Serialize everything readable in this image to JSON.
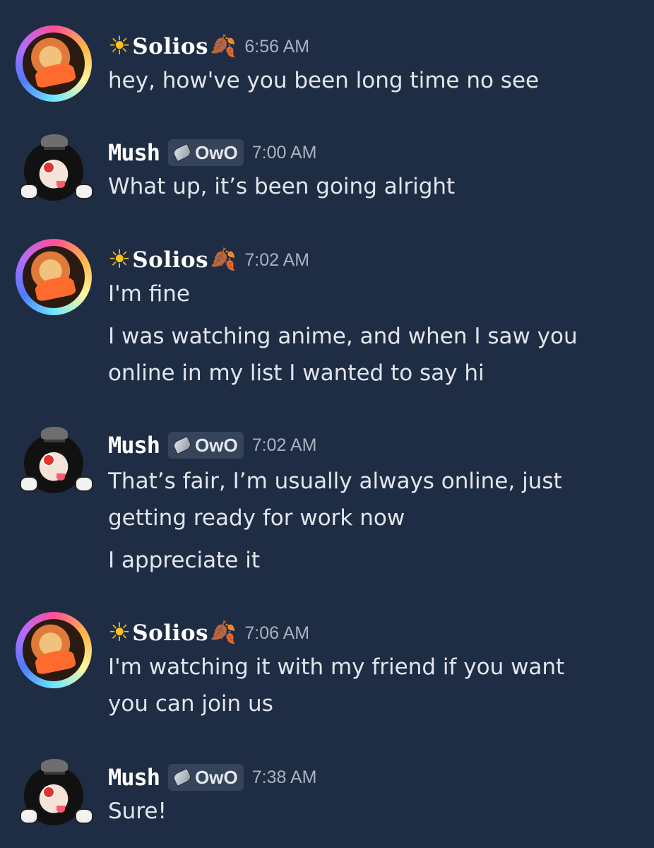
{
  "messages": [
    {
      "author": "Solios",
      "author_prefix_icon": "sun-emoji",
      "author_suffix_icon": "fallen-leaf-emoji",
      "time": "6:56 AM",
      "lines": [
        "hey, how've you been long time no see"
      ]
    },
    {
      "author": "Mush",
      "tag": "OwO",
      "tag_icon": "silver-leaf-icon",
      "time": "7:00 AM",
      "lines": [
        "What up, it’s been going alright"
      ]
    },
    {
      "author": "Solios",
      "author_prefix_icon": "sun-emoji",
      "author_suffix_icon": "fallen-leaf-emoji",
      "time": "7:02 AM",
      "lines": [
        "I'm fine",
        "I was watching anime, and when I saw you",
        "online in my list I wanted to say hi"
      ]
    },
    {
      "author": "Mush",
      "tag": "OwO",
      "tag_icon": "silver-leaf-icon",
      "time": "7:02 AM",
      "lines": [
        "That’s fair, I’m usually always online, just",
        "getting ready for work now",
        "I appreciate it"
      ]
    },
    {
      "author": "Solios",
      "author_prefix_icon": "sun-emoji",
      "author_suffix_icon": "fallen-leaf-emoji",
      "time": "7:06 AM",
      "lines": [
        "I'm watching it with my friend if you want",
        "you can join us"
      ]
    },
    {
      "author": "Mush",
      "tag": "OwO",
      "tag_icon": "silver-leaf-icon",
      "time": "7:38 AM",
      "lines": [
        "Sure!"
      ]
    }
  ],
  "colors": {
    "background": "#1f2d44",
    "username": "#ffffff",
    "timestamp": "#a9b1bf",
    "message_text": "#e1e5ec",
    "tag_background": "#36445b"
  }
}
